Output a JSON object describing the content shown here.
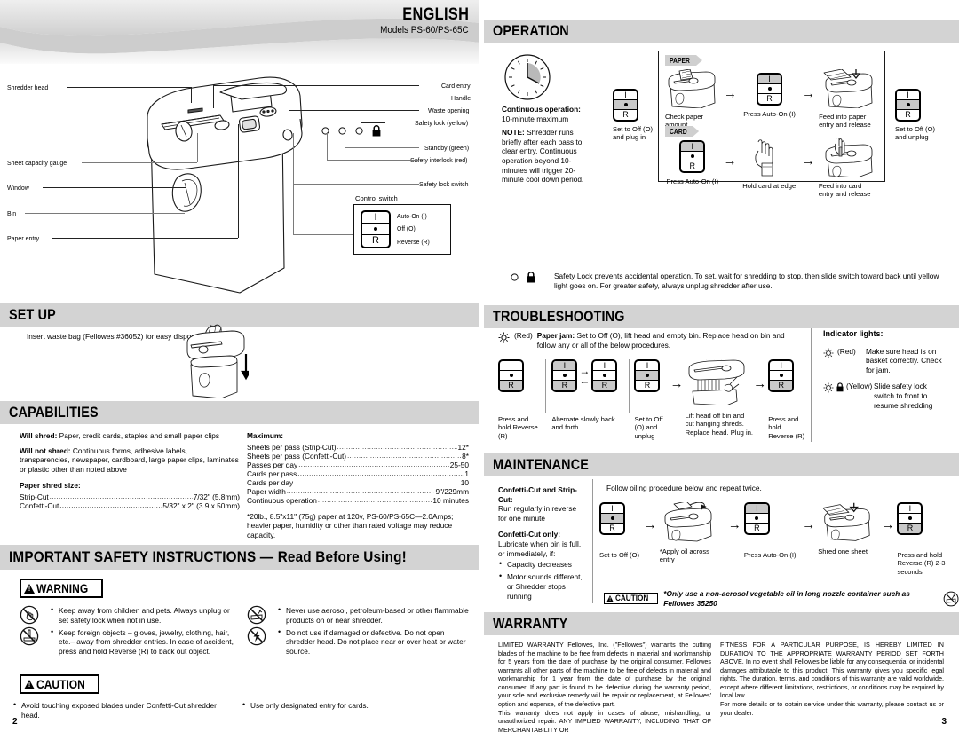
{
  "header": {
    "language": "ENGLISH",
    "models": "Models PS-60/PS-65C"
  },
  "page_numbers": {
    "left": "2",
    "right": "3"
  },
  "diagram": {
    "left_callouts": [
      "Shredder head",
      "Sheet capacity gauge",
      "Window",
      "Bin",
      "Paper entry"
    ],
    "right_callouts": [
      "Card entry",
      "Handle",
      "Waste opening",
      "Safety lock (yellow)",
      "Standby (green)",
      "Safety interlock (red)",
      "Safety lock switch"
    ],
    "control_switch_title": "Control switch",
    "control_switch_options": [
      "Auto-On (I)",
      "Off (O)",
      "Reverse (R)"
    ]
  },
  "sections": {
    "setup": "SET UP",
    "capabilities": "CAPABILITIES",
    "safety": "IMPORTANT SAFETY INSTRUCTIONS — Read Before Using!",
    "operation": "OPERATION",
    "troubleshooting": "TROUBLESHOOTING",
    "maintenance": "MAINTENANCE",
    "warranty": "WARRANTY"
  },
  "setup": {
    "text": "Insert waste bag (Fellowes #36052) for easy disposal."
  },
  "capabilities": {
    "will_shred_label": "Will shred:",
    "will_shred_text": "Paper, credit cards, staples and small paper clips",
    "will_not_shred_label": "Will not shred:",
    "will_not_shred_text": "Continuous forms, adhesive labels, transparencies, newspaper, cardboard, large paper clips, laminates or plastic other than noted above",
    "paper_shred_size_label": "Paper shred size:",
    "shred_sizes": [
      {
        "name": "Strip-Cut",
        "value": "7/32\" (5.8mm)"
      },
      {
        "name": "Confetti-Cut",
        "value": "5/32\" x 2\" (3.9 x 50mm)"
      }
    ],
    "maximum_label": "Maximum:",
    "maximum": [
      {
        "name": "Sheets per pass (Strip-Cut)",
        "value": "12*"
      },
      {
        "name": "Sheets per pass (Confetti-Cut)",
        "value": "8*"
      },
      {
        "name": "Passes per day",
        "value": "25-50"
      },
      {
        "name": "Cards per pass",
        "value": "1"
      },
      {
        "name": "Cards per day",
        "value": "10"
      },
      {
        "name": "Paper width",
        "value": "9\"/229mm"
      },
      {
        "name": "Continuous operation",
        "value": "10 minutes"
      }
    ],
    "footnote": "*20lb., 8.5\"x11\" (75g) paper at 120v, PS-60/PS-65C—2.0Amps; heavier paper, humidity or other than rated voltage may reduce capacity."
  },
  "safety": {
    "warning_label": "WARNING",
    "caution_label": "CAUTION",
    "warning_left": [
      "Keep away from children and pets. Always unplug or set safety lock when not in use.",
      "Keep foreign objects – gloves, jewelry, clothing, hair, etc.– away from shredder entries. In case of accident, press and hold Reverse (R) to back out object."
    ],
    "warning_right": [
      "Never use aerosol, petroleum-based or other flammable products on or near shredder.",
      "Do not use if damaged or defective. Do not open shredder head. Do not place near or over heat or water source."
    ],
    "caution_left": [
      "Avoid touching exposed blades under Confetti-Cut shredder head."
    ],
    "caution_right": [
      "Use only designated entry for cards."
    ]
  },
  "operation": {
    "clock_title": "Continuous operation:",
    "clock_text": "10-minute maximum",
    "note_label": "NOTE:",
    "note_text": "Shredder runs briefly after each pass to clear entry. Continuous operation beyond 10-minutes will trigger 20-minute cool  down period.",
    "start_caption": "Set to Off (O)\nand plug in",
    "end_caption": "Set to Off (O)\nand unplug",
    "paper_tag": "PAPER",
    "card_tag": "CARD",
    "paper_steps": [
      "Check paper amount",
      "Press Auto-On (I)",
      "Feed into paper entry and release"
    ],
    "card_steps": [
      "Press Auto-On (I)",
      "Hold card at edge",
      "Feed into card entry and release"
    ],
    "safety_lock_note": "Safety Lock prevents accidental operation. To set, wait for shredding to stop, then slide switch toward back until yellow light goes on. For greater safety, always unplug shredder after use."
  },
  "troubleshooting": {
    "red_tag": "(Red)",
    "jam_label": "Paper jam:",
    "jam_text": "Set to Off (O), lift head and empty bin. Replace head on bin and follow any or all of the below procedures.",
    "steps": [
      "Press and hold Reverse (R)",
      "Alternate slowly back and forth",
      "Set to Off (O) and unplug",
      "Lift head off bin and cut hanging shreds. Replace head. Plug in.",
      "Press and hold Reverse (R)"
    ],
    "indicator_title": "Indicator lights:",
    "indicators": [
      {
        "color": "(Red)",
        "text": "Make sure head is on basket correctly. Check for jam."
      },
      {
        "color": "(Yellow)",
        "text": "Slide safety lock switch to front to resume shredding"
      }
    ]
  },
  "maintenance": {
    "left_title_1": "Confetti-Cut and Strip-Cut:",
    "left_text_1": "Run regularly in reverse for one minute",
    "left_title_2": "Confetti-Cut only:",
    "left_text_2": "Lubricate when bin is full, or immediately, if:",
    "left_bullets": [
      "Capacity decreases",
      "Motor sounds different, or Shredder stops running"
    ],
    "intro": "Follow oiling procedure below and repeat twice.",
    "steps": [
      "Set to Off (O)",
      "*Apply oil across entry",
      "Press Auto-On (I)",
      "Shred one sheet",
      "Press and hold Reverse (R) 2-3 seconds"
    ],
    "caution_label": "CAUTION",
    "caution_text": "*Only use a non-aerosol vegetable oil in long nozzle container such as Fellowes 35250"
  },
  "warranty": {
    "left_paragraphs": [
      "LIMITED WARRANTY Fellowes, Inc. (\"Fellowes\") warrants the cutting blades of the machine to be free from defects in material and workmanship for 5 years from the date of purchase by the original consumer. Fellowes warrants all other parts of the machine to be free of defects in material and workmanship for 1 year from the date of purchase by the original consumer. If any part is found to be defective during the warranty period, your sole and exclusive remedy will be repair or replacement, at Fellowes' option and expense, of the defective part.",
      "This warranty does not apply in cases of abuse, mishandling, or unauthorized repair. ANY IMPLIED WARRANTY, INCLUDING THAT OF MERCHANTABILITY OR"
    ],
    "right_paragraphs": [
      "FITNESS FOR A PARTICULAR PURPOSE, IS HEREBY LIMITED IN DURATION TO THE APPROPRIATE WARRANTY PERIOD SET FORTH ABOVE. In no event shall Fellowes be liable for any consequential or incidental damages attributable to this product. This warranty gives you specific legal rights. The duration, terms, and conditions of this warranty are valid worldwide, except where different limitations, restrictions, or conditions may be required by local law.",
      "For more details or to obtain service under this warranty, please contact us or your dealer."
    ]
  },
  "colors": {
    "bar": "#d3d3d3",
    "tag": "#cfcfcf",
    "switch_highlight": "#c9c9c9"
  }
}
